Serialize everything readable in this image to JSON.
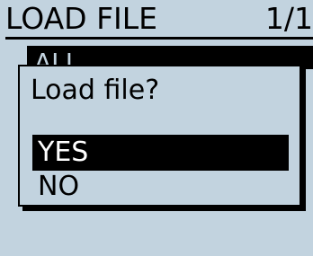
{
  "header": {
    "title": "LOAD FILE",
    "page_indicator": "1/1"
  },
  "list": {
    "items": [
      {
        "label": "ALL",
        "selected": true
      }
    ]
  },
  "dialog": {
    "message": "Load file?",
    "options": [
      {
        "label": "YES",
        "selected": true
      },
      {
        "label": "NO",
        "selected": false
      }
    ]
  },
  "colors": {
    "background": "#c2d3df",
    "foreground": "#000000",
    "highlight_text": "#ffffff"
  }
}
